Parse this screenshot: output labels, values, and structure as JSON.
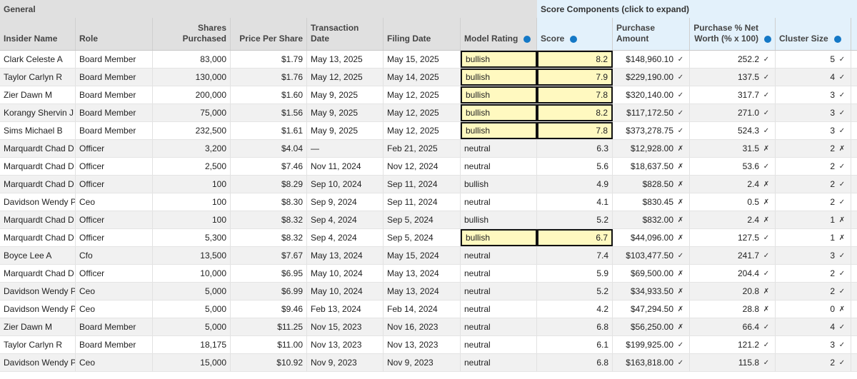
{
  "groups": {
    "general": "General",
    "score": "Score Components (click to expand)"
  },
  "headers": {
    "name": "Insider Name",
    "role": "Role",
    "shares": "Shares Purchased",
    "price": "Price Per Share",
    "tdate": "Transaction Date",
    "fdate": "Filing Date",
    "rating": "Model Rating",
    "score": "Score",
    "amount": "Purchase Amount",
    "pct": "Purchase % Net Worth (% x 100)",
    "cluster": "Cluster Size"
  },
  "colors": {
    "bullish_fill": "#fff9c0",
    "info_icon": "#1478c6",
    "score_group_bg": "#e3f1fb"
  },
  "rows": [
    {
      "name": "Clark Celeste A",
      "role": "Board Member",
      "shares": "83,000",
      "price": "$1.79",
      "tdate": "May 13, 2025",
      "fdate": "May 15, 2025",
      "rating": "bullish",
      "score": "8.2",
      "amount": "$148,960.10",
      "amount_mark": "✓",
      "pct": "252.2",
      "pct_mark": "✓",
      "cluster": "5",
      "cluster_mark": "✓",
      "hl": true
    },
    {
      "name": "Taylor Carlyn R",
      "role": "Board Member",
      "shares": "130,000",
      "price": "$1.76",
      "tdate": "May 12, 2025",
      "fdate": "May 14, 2025",
      "rating": "bullish",
      "score": "7.9",
      "amount": "$229,190.00",
      "amount_mark": "✓",
      "pct": "137.5",
      "pct_mark": "✓",
      "cluster": "4",
      "cluster_mark": "✓",
      "hl": true
    },
    {
      "name": "Zier Dawn M",
      "role": "Board Member",
      "shares": "200,000",
      "price": "$1.60",
      "tdate": "May 9, 2025",
      "fdate": "May 12, 2025",
      "rating": "bullish",
      "score": "7.8",
      "amount": "$320,140.00",
      "amount_mark": "✓",
      "pct": "317.7",
      "pct_mark": "✓",
      "cluster": "3",
      "cluster_mark": "✓",
      "hl": true
    },
    {
      "name": "Korangy Shervin J",
      "role": "Board Member",
      "shares": "75,000",
      "price": "$1.56",
      "tdate": "May 9, 2025",
      "fdate": "May 12, 2025",
      "rating": "bullish",
      "score": "8.2",
      "amount": "$117,172.50",
      "amount_mark": "✓",
      "pct": "271.0",
      "pct_mark": "✓",
      "cluster": "3",
      "cluster_mark": "✓",
      "hl": true
    },
    {
      "name": "Sims Michael B",
      "role": "Board Member",
      "shares": "232,500",
      "price": "$1.61",
      "tdate": "May 9, 2025",
      "fdate": "May 12, 2025",
      "rating": "bullish",
      "score": "7.8",
      "amount": "$373,278.75",
      "amount_mark": "✓",
      "pct": "524.3",
      "pct_mark": "✓",
      "cluster": "3",
      "cluster_mark": "✓",
      "hl": true
    },
    {
      "name": "Marquardt Chad D",
      "role": "Officer",
      "shares": "3,200",
      "price": "$4.04",
      "tdate": "—",
      "fdate": "Feb 21, 2025",
      "rating": "neutral",
      "score": "6.3",
      "amount": "$12,928.00",
      "amount_mark": "✗",
      "pct": "31.5",
      "pct_mark": "✗",
      "cluster": "2",
      "cluster_mark": "✗",
      "hl": false
    },
    {
      "name": "Marquardt Chad D",
      "role": "Officer",
      "shares": "2,500",
      "price": "$7.46",
      "tdate": "Nov 11, 2024",
      "fdate": "Nov 12, 2024",
      "rating": "neutral",
      "score": "5.6",
      "amount": "$18,637.50",
      "amount_mark": "✗",
      "pct": "53.6",
      "pct_mark": "✓",
      "cluster": "2",
      "cluster_mark": "✓",
      "hl": false
    },
    {
      "name": "Marquardt Chad D",
      "role": "Officer",
      "shares": "100",
      "price": "$8.29",
      "tdate": "Sep 10, 2024",
      "fdate": "Sep 11, 2024",
      "rating": "bullish",
      "score": "4.9",
      "amount": "$828.50",
      "amount_mark": "✗",
      "pct": "2.4",
      "pct_mark": "✗",
      "cluster": "2",
      "cluster_mark": "✓",
      "hl": false
    },
    {
      "name": "Davidson Wendy P",
      "role": "Ceo",
      "shares": "100",
      "price": "$8.30",
      "tdate": "Sep 9, 2024",
      "fdate": "Sep 11, 2024",
      "rating": "neutral",
      "score": "4.1",
      "amount": "$830.45",
      "amount_mark": "✗",
      "pct": "0.5",
      "pct_mark": "✗",
      "cluster": "2",
      "cluster_mark": "✓",
      "hl": false
    },
    {
      "name": "Marquardt Chad D",
      "role": "Officer",
      "shares": "100",
      "price": "$8.32",
      "tdate": "Sep 4, 2024",
      "fdate": "Sep 5, 2024",
      "rating": "bullish",
      "score": "5.2",
      "amount": "$832.00",
      "amount_mark": "✗",
      "pct": "2.4",
      "pct_mark": "✗",
      "cluster": "1",
      "cluster_mark": "✗",
      "hl": false
    },
    {
      "name": "Marquardt Chad D",
      "role": "Officer",
      "shares": "5,300",
      "price": "$8.32",
      "tdate": "Sep 4, 2024",
      "fdate": "Sep 5, 2024",
      "rating": "bullish",
      "score": "6.7",
      "amount": "$44,096.00",
      "amount_mark": "✗",
      "pct": "127.5",
      "pct_mark": "✓",
      "cluster": "1",
      "cluster_mark": "✗",
      "hl": true
    },
    {
      "name": "Boyce Lee A",
      "role": "Cfo",
      "shares": "13,500",
      "price": "$7.67",
      "tdate": "May 13, 2024",
      "fdate": "May 15, 2024",
      "rating": "neutral",
      "score": "7.4",
      "amount": "$103,477.50",
      "amount_mark": "✓",
      "pct": "241.7",
      "pct_mark": "✓",
      "cluster": "3",
      "cluster_mark": "✓",
      "hl": false
    },
    {
      "name": "Marquardt Chad D",
      "role": "Officer",
      "shares": "10,000",
      "price": "$6.95",
      "tdate": "May 10, 2024",
      "fdate": "May 13, 2024",
      "rating": "neutral",
      "score": "5.9",
      "amount": "$69,500.00",
      "amount_mark": "✗",
      "pct": "204.4",
      "pct_mark": "✓",
      "cluster": "2",
      "cluster_mark": "✓",
      "hl": false
    },
    {
      "name": "Davidson Wendy P",
      "role": "Ceo",
      "shares": "5,000",
      "price": "$6.99",
      "tdate": "May 10, 2024",
      "fdate": "May 13, 2024",
      "rating": "neutral",
      "score": "5.2",
      "amount": "$34,933.50",
      "amount_mark": "✗",
      "pct": "20.8",
      "pct_mark": "✗",
      "cluster": "2",
      "cluster_mark": "✓",
      "hl": false
    },
    {
      "name": "Davidson Wendy P",
      "role": "Ceo",
      "shares": "5,000",
      "price": "$9.46",
      "tdate": "Feb 13, 2024",
      "fdate": "Feb 14, 2024",
      "rating": "neutral",
      "score": "4.2",
      "amount": "$47,294.50",
      "amount_mark": "✗",
      "pct": "28.8",
      "pct_mark": "✗",
      "cluster": "0",
      "cluster_mark": "✗",
      "hl": false
    },
    {
      "name": "Zier Dawn M",
      "role": "Board Member",
      "shares": "5,000",
      "price": "$11.25",
      "tdate": "Nov 15, 2023",
      "fdate": "Nov 16, 2023",
      "rating": "neutral",
      "score": "6.8",
      "amount": "$56,250.00",
      "amount_mark": "✗",
      "pct": "66.4",
      "pct_mark": "✓",
      "cluster": "4",
      "cluster_mark": "✓",
      "hl": false
    },
    {
      "name": "Taylor Carlyn R",
      "role": "Board Member",
      "shares": "18,175",
      "price": "$11.00",
      "tdate": "Nov 13, 2023",
      "fdate": "Nov 13, 2023",
      "rating": "neutral",
      "score": "6.1",
      "amount": "$199,925.00",
      "amount_mark": "✓",
      "pct": "121.2",
      "pct_mark": "✓",
      "cluster": "3",
      "cluster_mark": "✓",
      "hl": false
    },
    {
      "name": "Davidson Wendy P",
      "role": "Ceo",
      "shares": "15,000",
      "price": "$10.92",
      "tdate": "Nov 9, 2023",
      "fdate": "Nov 9, 2023",
      "rating": "neutral",
      "score": "6.8",
      "amount": "$163,818.00",
      "amount_mark": "✓",
      "pct": "115.8",
      "pct_mark": "✓",
      "cluster": "2",
      "cluster_mark": "✓",
      "hl": false
    }
  ]
}
